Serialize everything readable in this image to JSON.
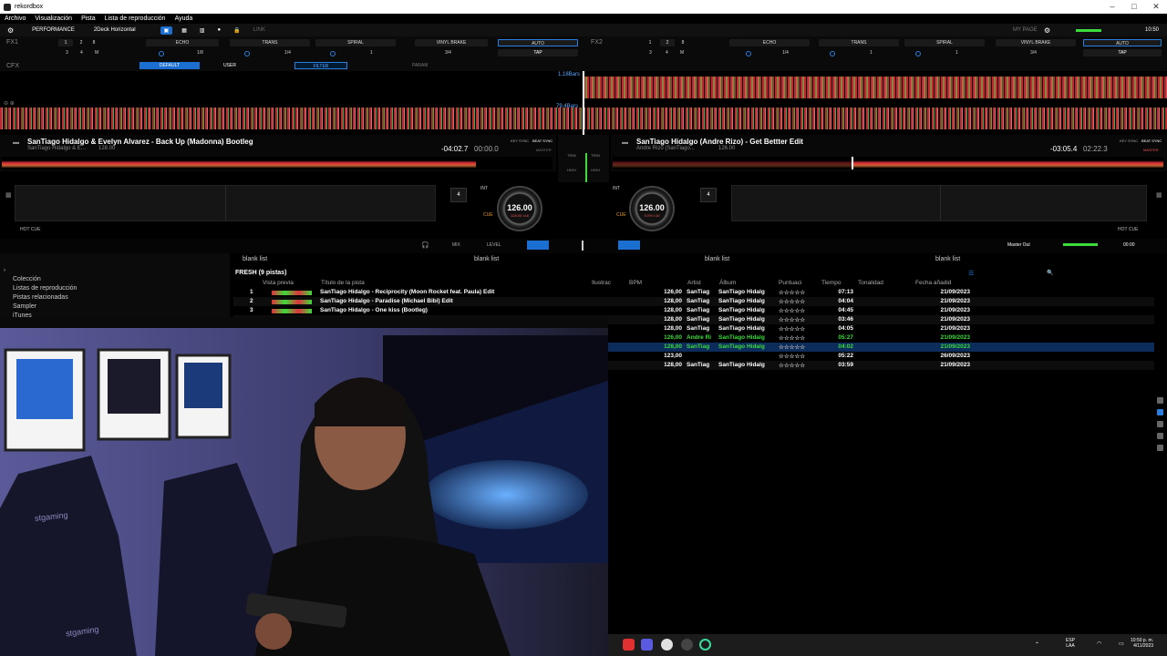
{
  "app": {
    "title": "rekordbox"
  },
  "menu": [
    "Archivo",
    "Visualización",
    "Pista",
    "Lista de reproducción",
    "Ayuda"
  ],
  "topbar": {
    "mode": "PERFORMANCE",
    "layout": "2Deck Horizontal",
    "link": "LINK",
    "mypage": "MY PAGE",
    "clock": "10:50"
  },
  "fx1": {
    "label": "FX1",
    "effects": [
      "ECHO",
      "TRANS",
      "SPIRAL",
      "VINYL BRAKE"
    ],
    "beats": [
      "1/8",
      "1/4",
      "1",
      "3/4"
    ],
    "auto": "AUTO",
    "tap": "TAP",
    "digits": [
      "1",
      "2",
      "8",
      "3",
      "4",
      "M"
    ]
  },
  "fx2": {
    "label": "FX2",
    "effects": [
      "ECHO",
      "TRANS",
      "SPIRAL",
      "VINYL BRAKE"
    ],
    "beats": [
      "1/4",
      "1",
      "1",
      "3/4"
    ],
    "auto": "AUTO",
    "tap": "TAP",
    "digits": [
      "1",
      "2",
      "8",
      "3",
      "4",
      "M"
    ]
  },
  "cfx": {
    "label": "CFX",
    "default": "DEFAULT",
    "user": "USER",
    "filter": "FILTER",
    "param": "PARAM"
  },
  "waveform": {
    "bars1": "1.18Bars",
    "bars2": "79.4Bars"
  },
  "deck1": {
    "title": "SanTiago Hidalgo & Evelyn Alvarez - Back Up (Madonna) Bootleg",
    "artist": "SanTiago Hidalgo & E...",
    "bpm_small": "128.00",
    "remain": "-04:02.7",
    "elapsed": "00:00.0",
    "key_sync": "KEY SYNC",
    "beat_sync": "BEAT SYNC",
    "master": "MASTER",
    "jog_bpm": "126.00",
    "jog_sub": "128.00  ±16",
    "beatjump": "4",
    "int": "INT",
    "hot_cue": "HOT CUE",
    "cue": "CUE"
  },
  "deck2": {
    "title": "SanTiago Hidalgo (Andre Rizo) - Get Bettter Edit",
    "artist": "Andre Rizo (SanTiago...",
    "bpm_small": "126.00",
    "remain": "-03:05.4",
    "elapsed": "02:22.3",
    "key_sync": "KEY SYNC",
    "beat_sync": "BEAT SYNC",
    "master": "MASTER",
    "jog_bpm": "126.00",
    "jog_sub": "0.0%  ±10",
    "beatjump": "4",
    "int": "INT",
    "hot_cue": "HOT CUE",
    "cue": "CUE"
  },
  "mixer": {
    "trim": "TRIM",
    "high": "HIGH",
    "mid": "MID",
    "low": "LOW",
    "cue": "CUE",
    "mix": "MIX",
    "level": "LEVEL",
    "master_out": "Master Out",
    "time": "00:00"
  },
  "browser": {
    "tree": [
      "Colección",
      "Listas de reproducción",
      "Pistas relacionadas",
      "Sampler",
      "iTunes"
    ],
    "tabs": [
      "blank list",
      "blank list",
      "blank list",
      "blank list"
    ],
    "list_title": "FRESH (9 pistas)",
    "columns": [
      "Vista previa",
      "Título de la pista",
      "Ilustrac",
      "BPM",
      "Artist",
      "Álbum",
      "Puntuaci",
      "Tiempo",
      "Tonalidad",
      "Fecha añadid"
    ],
    "rows": [
      {
        "n": "1",
        "title": "SanTiago Hidalgo - Reciprocity (Moon Rocket feat. Paula) Edit",
        "bpm": "126,00",
        "artist": "SanTiag",
        "album": "SanTiago Hidalg",
        "rating": "☆☆☆☆☆",
        "time": "07:13",
        "date": "21/09/2023",
        "style": ""
      },
      {
        "n": "2",
        "title": "SanTiago Hidalgo - Paradise (Michael Bibi) Edit",
        "bpm": "128,00",
        "artist": "SanTiag",
        "album": "SanTiago Hidalg",
        "rating": "☆☆☆☆☆",
        "time": "04:04",
        "date": "21/09/2023",
        "style": "alt"
      },
      {
        "n": "3",
        "title": "SanTiago Hidalgo - One kiss (Bootleg)",
        "bpm": "128,00",
        "artist": "SanTiag",
        "album": "SanTiago Hidalg",
        "rating": "☆☆☆☆☆",
        "time": "04:45",
        "date": "21/09/2023",
        "style": ""
      },
      {
        "n": "",
        "title": "",
        "bpm": "128,00",
        "artist": "SanTiag",
        "album": "SanTiago Hidalg",
        "rating": "☆☆☆☆☆",
        "time": "03:46",
        "date": "21/09/2023",
        "style": "alt"
      },
      {
        "n": "",
        "title": "",
        "bpm": "128,00",
        "artist": "SanTiag",
        "album": "SanTiago Hidalg",
        "rating": "☆☆☆☆☆",
        "time": "04:05",
        "date": "21/09/2023",
        "style": ""
      },
      {
        "n": "",
        "title": "",
        "bpm": "126,00",
        "artist": "Andre Ri",
        "album": "SanTiago Hidalg",
        "rating": "☆☆☆☆☆",
        "time": "05:27",
        "date": "21/09/2023",
        "style": "green"
      },
      {
        "n": "",
        "title": "",
        "bpm": "128,00",
        "artist": "SanTiag",
        "album": "SanTiago Hidalg",
        "rating": "☆☆☆☆☆",
        "time": "04:02",
        "date": "21/09/2023",
        "style": "green sel"
      },
      {
        "n": "",
        "title": "",
        "bpm": "123,00",
        "artist": "",
        "album": "",
        "rating": "☆☆☆☆☆",
        "time": "05:22",
        "date": "26/09/2023",
        "style": ""
      },
      {
        "n": "",
        "title": "",
        "bpm": "128,00",
        "artist": "SanTiag",
        "album": "SanTiago Hidalg",
        "rating": "☆☆☆☆☆",
        "time": "03:59",
        "date": "21/09/2023",
        "style": "alt"
      }
    ]
  },
  "webcam": {
    "chair_text_left": "stgaming",
    "chair_text_right": "stgaming"
  },
  "taskbar": {
    "lang": "ESP",
    "lang2": "LAA",
    "time": "10:50 p. m.",
    "date": "4/11/2023"
  },
  "colors": {
    "accent": "#1a6fd0",
    "wave_red": "#e0303a",
    "green": "#3bdc3b",
    "selected": "#0c2c5c"
  }
}
